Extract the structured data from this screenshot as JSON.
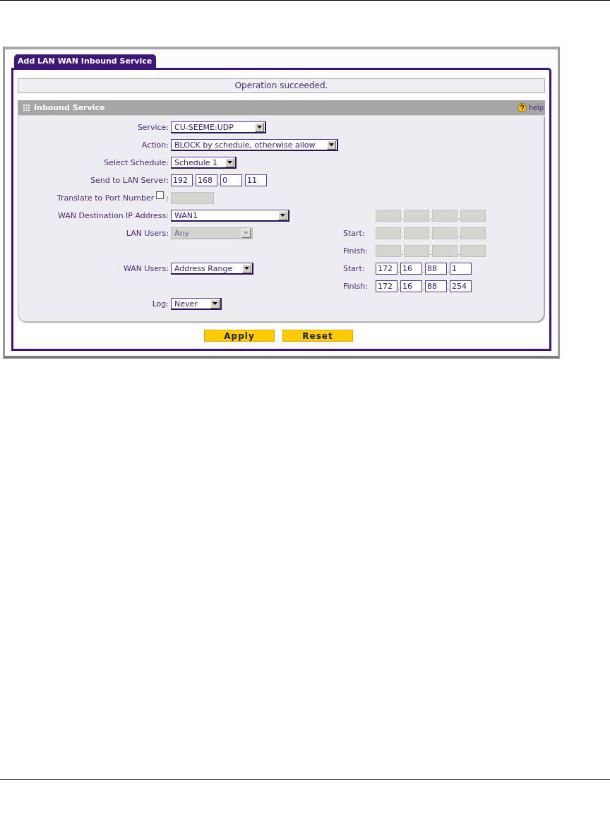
{
  "tab": {
    "label": "Add LAN WAN Inbound Service",
    "selected": true
  },
  "message": "Operation succeeded.",
  "section": {
    "title": "Inbound Service",
    "help": "help"
  },
  "separator": ".",
  "rows": [
    {
      "label": "Service:",
      "control": {
        "kind": "select",
        "value": "CU-SEEME:UDP",
        "disabled": false
      }
    },
    {
      "label": "Action:",
      "control": {
        "kind": "select",
        "value": "BLOCK by schedule, otherwise allow",
        "disabled": false
      }
    },
    {
      "label": "Select Schedule:",
      "control": {
        "kind": "select",
        "value": "Schedule 1",
        "disabled": false
      }
    },
    {
      "label": "Send to LAN Server:",
      "control": {
        "kind": "ip",
        "octets": [
          "192",
          "168",
          "0",
          "11"
        ],
        "disabled": false
      }
    },
    {
      "label": "Translate to Port Number",
      "control": {
        "kind": "port",
        "checked": false,
        "colon": ":",
        "disabled": true
      }
    },
    {
      "label": "WAN Destination IP Address:",
      "control": {
        "kind": "select",
        "value": "WAN1",
        "disabled": false
      },
      "right": {
        "ip": {
          "disabled": true
        }
      }
    },
    {
      "label": "LAN Users:",
      "control": {
        "kind": "select",
        "value": "Any",
        "disabled": true
      },
      "right": {
        "label": "Start:",
        "ip": {
          "disabled": true
        }
      }
    },
    {
      "right": {
        "label": "Finish:",
        "ip": {
          "disabled": true
        }
      }
    },
    {
      "label": "WAN Users:",
      "control": {
        "kind": "select",
        "value": "Address Range",
        "disabled": false
      },
      "right": {
        "label": "Start:",
        "ip": {
          "octets": [
            "172",
            "16",
            "88",
            "1"
          ],
          "disabled": false
        }
      }
    },
    {
      "right": {
        "label": "Finish:",
        "ip": {
          "octets": [
            "172",
            "16",
            "88",
            "254"
          ],
          "disabled": false
        }
      }
    },
    {
      "label": "Log:",
      "control": {
        "kind": "select",
        "value": "Never",
        "disabled": false
      }
    }
  ],
  "buttons": [
    "Apply",
    "Reset"
  ]
}
